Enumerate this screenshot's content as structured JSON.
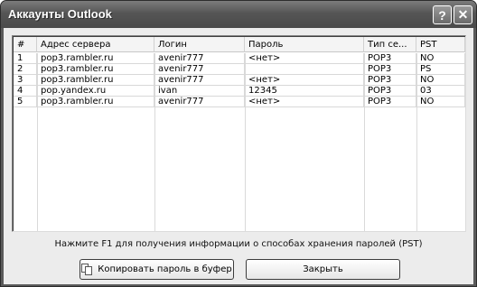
{
  "window": {
    "title": "Аккаунты Outlook",
    "help_glyph": "?",
    "close_glyph": "✕"
  },
  "table": {
    "headers": [
      "#",
      "Адрес сервера",
      "Логин",
      "Пароль",
      "Тип се...",
      "PST"
    ],
    "rows": [
      [
        "1",
        "pop3.rambler.ru",
        "avenir777",
        "<нет>",
        "POP3",
        "NO"
      ],
      [
        "2",
        "pop3.rambler.ru",
        "avenir777",
        "",
        "POP3",
        "PS"
      ],
      [
        "3",
        "pop3.rambler.ru",
        "avenir777",
        "<нет>",
        "POP3",
        "NO"
      ],
      [
        "4",
        "pop.yandex.ru",
        "ivan",
        "12345",
        "POP3",
        "03"
      ],
      [
        "5",
        "pop3.rambler.ru",
        "avenir777",
        "<нет>",
        "POP3",
        "NO"
      ]
    ]
  },
  "hint": "Нажмите F1 для получения информации о способах хранения паролей (PST)",
  "buttons": {
    "copy": "Копировать пароль в буфер",
    "close": "Закрыть"
  }
}
